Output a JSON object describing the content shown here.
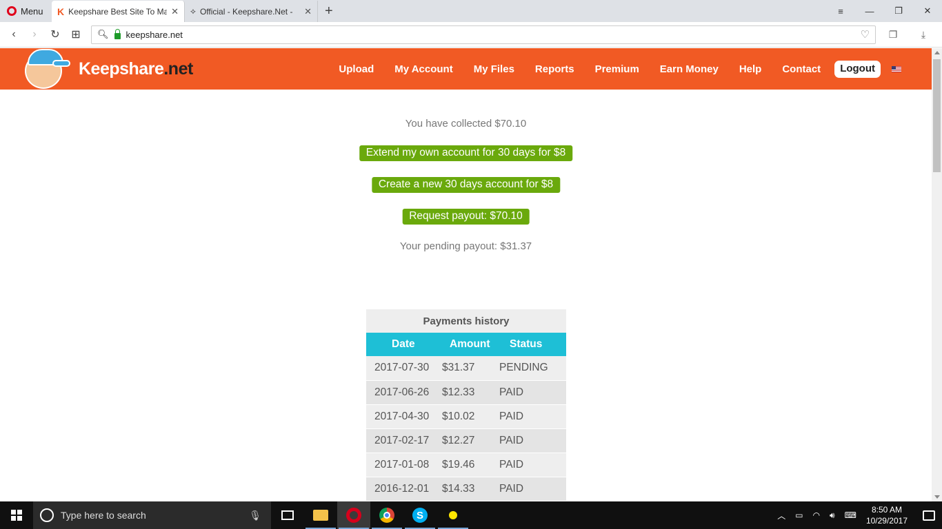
{
  "browser": {
    "menu_label": "Menu",
    "tabs": [
      {
        "title": "Keepshare Best Site To Ma",
        "active": true
      },
      {
        "title": "Official - Keepshare.Net -",
        "active": false
      }
    ],
    "url": "keepshare.net"
  },
  "site": {
    "brand_name": "Keepshare",
    "brand_tld": ".net",
    "nav": [
      "Upload",
      "My Account",
      "My Files",
      "Reports",
      "Premium",
      "Earn Money",
      "Help",
      "Contact"
    ],
    "logout_label": "Logout"
  },
  "earnings": {
    "collected_text": "You have collected $70.10",
    "extend_button": "Extend my own account for 30 days for $8",
    "create_button": "Create a new 30 days account for $8",
    "payout_button": "Request payout: $70.10",
    "pending_text": "Your pending payout: $31.37"
  },
  "payments_history": {
    "title": "Payments history",
    "columns": [
      "Date",
      "Amount",
      "Status"
    ],
    "rows": [
      {
        "date": "2017-07-30",
        "amount": "$31.37",
        "status": "PENDING"
      },
      {
        "date": "2017-06-26",
        "amount": "$12.33",
        "status": "PAID"
      },
      {
        "date": "2017-04-30",
        "amount": "$10.02",
        "status": "PAID"
      },
      {
        "date": "2017-02-17",
        "amount": "$12.27",
        "status": "PAID"
      },
      {
        "date": "2017-01-08",
        "amount": "$19.46",
        "status": "PAID"
      },
      {
        "date": "2016-12-01",
        "amount": "$14.33",
        "status": "PAID"
      }
    ]
  },
  "taskbar": {
    "search_placeholder": "Type here to search",
    "time": "8:50 AM",
    "date": "10/29/2017"
  },
  "colors": {
    "header_orange": "#f15a24",
    "button_green": "#6aa90c",
    "table_header_cyan": "#1ebfd6"
  }
}
